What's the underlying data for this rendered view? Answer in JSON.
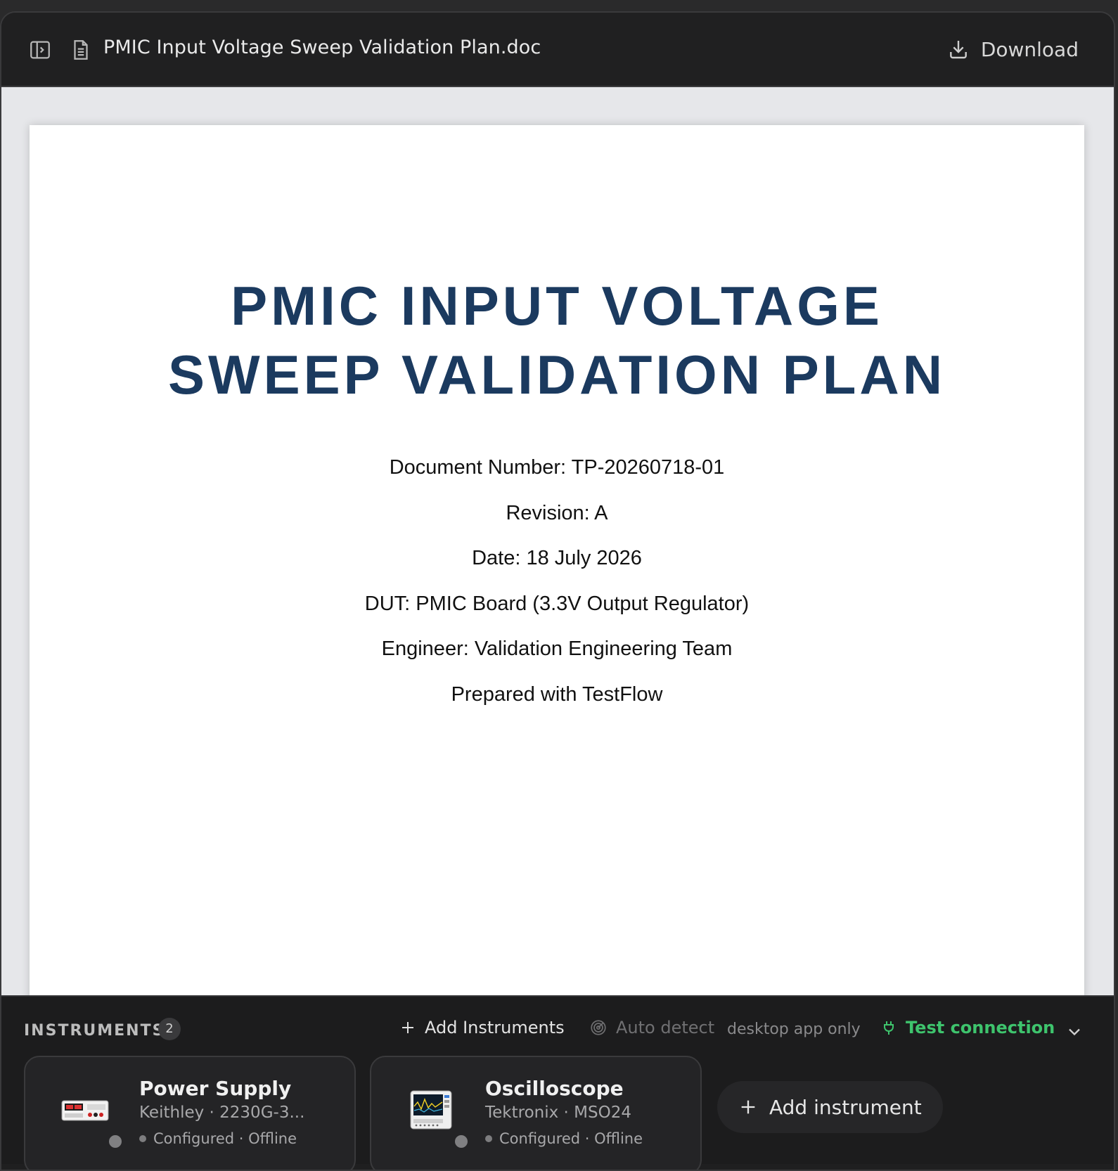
{
  "titlebar": {
    "document_name": "PMIC Input Voltage Sweep Validation Plan.doc",
    "download_label": "Download",
    "icons": [
      "sidebar-toggle-icon",
      "document-icon",
      "download-icon"
    ]
  },
  "document": {
    "title_line1": "PMIC INPUT VOLTAGE",
    "title_line2": "SWEEP VALIDATION PLAN",
    "meta": [
      "Document Number: TP-20260718-01",
      "Revision: A",
      "Date: 18 July 2026",
      "DUT: PMIC Board (3.3V Output Regulator)",
      "Engineer: Validation Engineering Team",
      "Prepared with TestFlow"
    ],
    "title_color": "#1b3a5f"
  },
  "instruments": {
    "label": "INSTRUMENTS",
    "count": "2",
    "add_instruments_label": "Add Instruments",
    "auto_detect_label": "Auto detect",
    "desktop_only_label": "desktop app only",
    "test_connection_label": "Test connection",
    "add_instrument_label": "Add instrument",
    "accent_color": "#3ec46d",
    "cards": [
      {
        "name": "Power Supply",
        "vendor_model": "Keithley · 2230G-3...",
        "status": "Configured · Offline",
        "icon": "power-supply-icon"
      },
      {
        "name": "Oscilloscope",
        "vendor_model": "Tektronix · MSO24",
        "status": "Configured · Offline",
        "icon": "oscilloscope-icon"
      }
    ]
  }
}
